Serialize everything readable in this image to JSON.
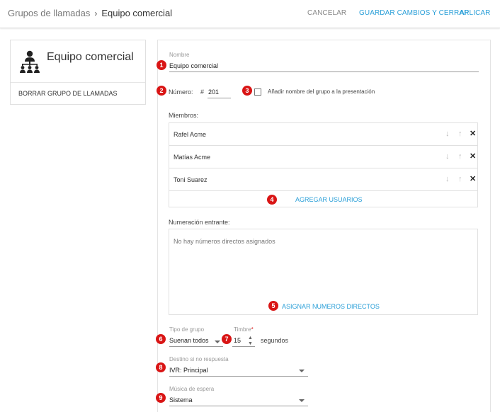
{
  "topbar": {
    "breadcrumb_parent": "Grupos de llamadas",
    "breadcrumb_separator": "›",
    "breadcrumb_current": "Equipo comercial",
    "cancel_label": "CANCELAR",
    "save_label": "GUARDAR CAMBIOS Y CERRAR",
    "apply_label": "APLICAR"
  },
  "sidebar": {
    "group_title": "Equipo comercial",
    "delete_label": "BORRAR GRUPO DE LLAMADAS"
  },
  "form": {
    "name_label": "Nombre",
    "name_value": "Equipo comercial",
    "number_label": "Número:",
    "number_prefix": "#",
    "number_value": "201",
    "add_name_checkbox_label": "Añadir nombre del grupo a la presentación",
    "add_name_checked": false,
    "members_label": "Miembros:",
    "members": [
      {
        "name": "Rafel Acme"
      },
      {
        "name": "Matías Acme"
      },
      {
        "name": "Toni Suarez"
      }
    ],
    "move_down_glyph": "↓",
    "move_up_glyph": "↑",
    "remove_glyph": "✕",
    "add_users_label": "AGREGAR USUARIOS",
    "incoming_label": "Numeración entrante:",
    "incoming_empty": "No hay números directos asignados",
    "assign_dids_label": "ASIGNAR NUMEROS DIRECTOS",
    "group_type_label": "Tipo de grupo",
    "group_type_value": "Suenan todos",
    "ring_label": "Timbre",
    "ring_required_mark": "*",
    "ring_value": "15",
    "ring_unit": "segundos",
    "no_answer_label": "Destino si no respuesta",
    "no_answer_value": "IVR: Principal",
    "hold_music_label": "Música de espera",
    "hold_music_value": "Sistema"
  },
  "badges": [
    "1",
    "2",
    "3",
    "4",
    "5",
    "6",
    "7",
    "8",
    "9"
  ],
  "colors": {
    "accent": "#2a9fd8",
    "badge": "#d91515",
    "border": "#e0e0e0"
  },
  "icons": {
    "group": "group-hierarchy-icon",
    "move_down": "arrow-down-icon",
    "move_up": "arrow-up-icon",
    "remove": "close-icon",
    "select": "chevron-down-icon"
  }
}
